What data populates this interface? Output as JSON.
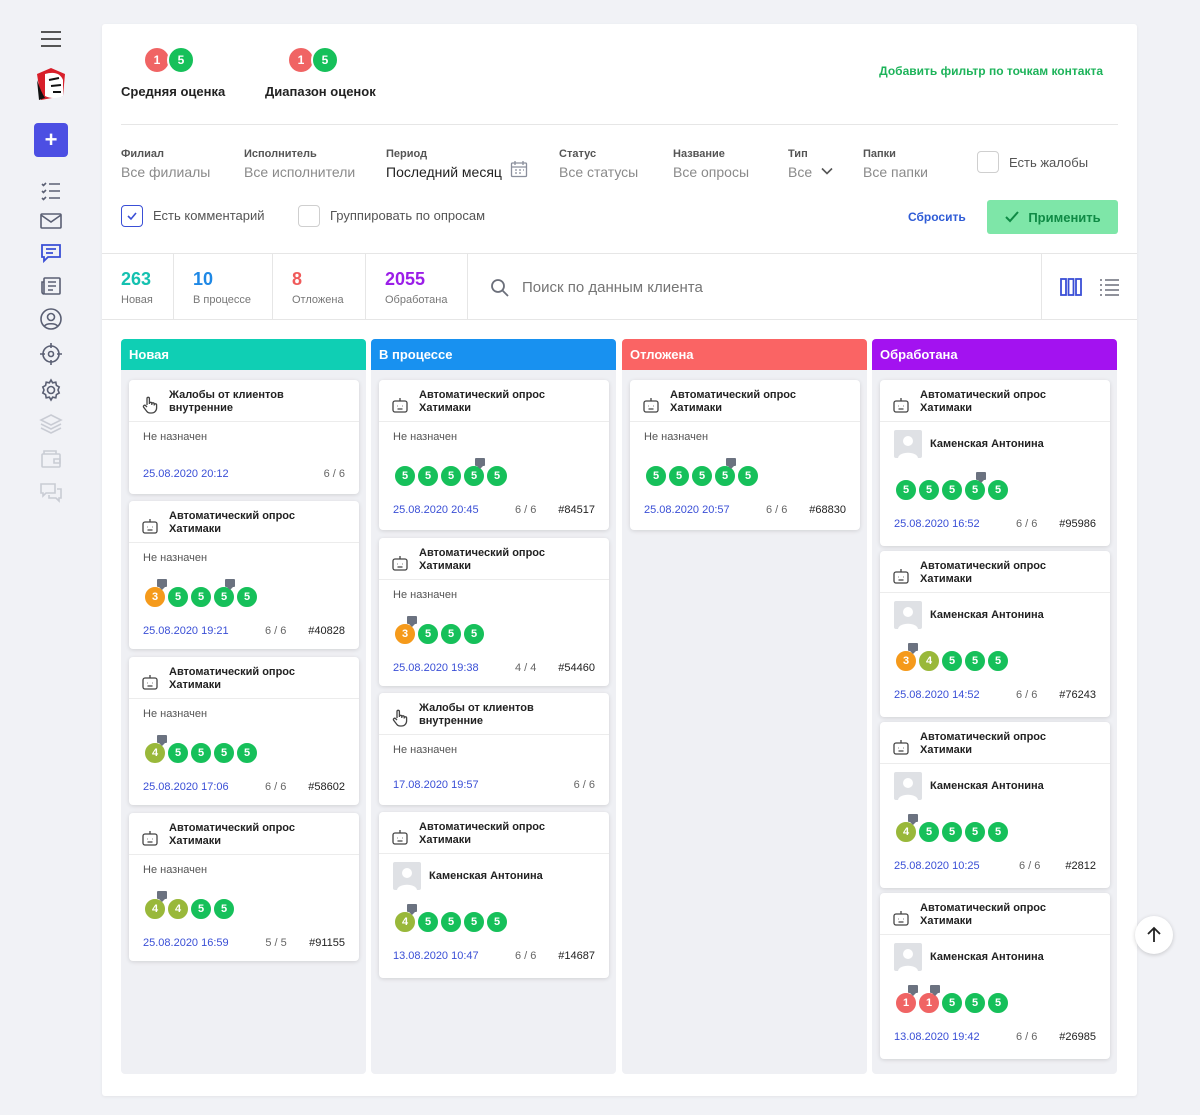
{
  "scores": {
    "avg": {
      "min": "1",
      "max": "5",
      "label": "Средняя оценка"
    },
    "range": {
      "min": "1",
      "max": "5",
      "label": "Диапазон оценок"
    }
  },
  "add_filter_label": "Добавить фильтр по точкам контакта",
  "filters": {
    "branch": {
      "label": "Филиал",
      "value": "Все филиалы"
    },
    "executor": {
      "label": "Исполнитель",
      "value": "Все исполнители"
    },
    "period": {
      "label": "Период",
      "value": "Последний месяц"
    },
    "status": {
      "label": "Статус",
      "value": "Все статусы"
    },
    "name": {
      "label": "Название",
      "value": "Все опросы"
    },
    "type": {
      "label": "Тип",
      "value": "Все"
    },
    "folders": {
      "label": "Папки",
      "value": "Все папки"
    },
    "complaints_label": "Есть жалобы",
    "comment_label": "Есть комментарий",
    "group_label": "Группировать по опросам",
    "reset_label": "Сбросить",
    "apply_label": "Применить"
  },
  "stats": [
    {
      "count": "263",
      "label": "Новая",
      "color": "#14c1b0"
    },
    {
      "count": "10",
      "label": "В процессе",
      "color": "#1e88e5"
    },
    {
      "count": "8",
      "label": "Отложена",
      "color": "#f05a5a"
    },
    {
      "count": "2055",
      "label": "Обработана",
      "color": "#9b1ee8"
    }
  ],
  "search": {
    "placeholder": "Поиск по данным клиента"
  },
  "columns": [
    {
      "title": "Новая",
      "color": "#0fcfb4"
    },
    {
      "title": "В процессе",
      "color": "#1891f0"
    },
    {
      "title": "Отложена",
      "color": "#fa6464"
    },
    {
      "title": "Обработана",
      "color": "#a312f0"
    }
  ],
  "cards": {
    "c1_1": {
      "title1": "Жалобы от клиентов",
      "title2": "внутренние",
      "assign": "Не назначен",
      "date": "25.08.2020 20:12",
      "count": "6 / 6",
      "num": ""
    },
    "c1_2": {
      "title1": "Автоматический опрос",
      "title2": "Хатимаки",
      "assign": "Не назначен",
      "date": "25.08.2020 19:21",
      "count": "6 / 6",
      "num": "#40828",
      "scores": [
        "3",
        "5",
        "5",
        "5",
        "5"
      ]
    },
    "c1_3": {
      "title1": "Автоматический опрос",
      "title2": "Хатимаки",
      "assign": "Не назначен",
      "date": "25.08.2020 17:06",
      "count": "6 / 6",
      "num": "#58602",
      "scores": [
        "4",
        "5",
        "5",
        "5",
        "5"
      ]
    },
    "c1_4": {
      "title1": "Автоматический опрос",
      "title2": "Хатимаки",
      "assign": "Не назначен",
      "date": "25.08.2020 16:59",
      "count": "5 / 5",
      "num": "#91155",
      "scores": [
        "4",
        "4",
        "5",
        "5"
      ]
    },
    "c2_1": {
      "title1": "Автоматический опрос",
      "title2": "Хатимаки",
      "assign": "Не назначен",
      "date": "25.08.2020 20:45",
      "count": "6 / 6",
      "num": "#84517",
      "scores": [
        "5",
        "5",
        "5",
        "5",
        "5"
      ]
    },
    "c2_2": {
      "title1": "Автоматический опрос",
      "title2": "Хатимаки",
      "assign": "Не назначен",
      "date": "25.08.2020 19:38",
      "count": "4 / 4",
      "num": "#54460",
      "scores": [
        "3",
        "5",
        "5",
        "5"
      ]
    },
    "c2_3": {
      "title1": "Жалобы от клиентов",
      "title2": "внутренние",
      "assign": "Не назначен",
      "date": "17.08.2020 19:57",
      "count": "6 / 6",
      "num": ""
    },
    "c2_4": {
      "title1": "Автоматический опрос",
      "title2": "Хатимаки",
      "person": "Каменская Антонина",
      "date": "13.08.2020 10:47",
      "count": "6 / 6",
      "num": "#14687",
      "scores": [
        "4",
        "5",
        "5",
        "5",
        "5"
      ]
    },
    "c3_1": {
      "title1": "Автоматический опрос",
      "title2": "Хатимаки",
      "assign": "Не назначен",
      "date": "25.08.2020 20:57",
      "count": "6 / 6",
      "num": "#68830",
      "scores": [
        "5",
        "5",
        "5",
        "5",
        "5"
      ]
    },
    "c4_1": {
      "title1": "Автоматический опрос",
      "title2": "Хатимаки",
      "person": "Каменская Антонина",
      "date": "25.08.2020 16:52",
      "count": "6 / 6",
      "num": "#95986",
      "scores": [
        "5",
        "5",
        "5",
        "5",
        "5"
      ]
    },
    "c4_2": {
      "title1": "Автоматический опрос",
      "title2": "Хатимаки",
      "person": "Каменская Антонина",
      "date": "25.08.2020 14:52",
      "count": "6 / 6",
      "num": "#76243",
      "scores": [
        "3",
        "4",
        "5",
        "5",
        "5"
      ]
    },
    "c4_3": {
      "title1": "Автоматический опрос",
      "title2": "Хатимаки",
      "person": "Каменская Антонина",
      "date": "25.08.2020 10:25",
      "count": "6 / 6",
      "num": "#2812",
      "scores": [
        "4",
        "5",
        "5",
        "5",
        "5"
      ]
    },
    "c4_4": {
      "title1": "Автоматический опрос",
      "title2": "Хатимаки",
      "person": "Каменская Антонина",
      "date": "13.08.2020 19:42",
      "count": "6 / 6",
      "num": "#26985",
      "scores": [
        "1",
        "1",
        "5",
        "5",
        "5"
      ]
    }
  }
}
